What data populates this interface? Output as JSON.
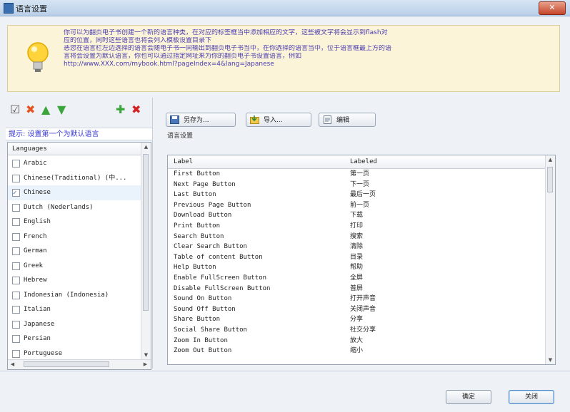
{
  "window": {
    "title": "语言设置",
    "close_label": "✕"
  },
  "info": {
    "lines": [
      "你可以为翻页电子书创建一个新的语言种类，在对应的标签框当中添加相应的文字，这些被文字将会显示到flash对",
      "应的位置，同时这些语言也将会列入模板设置目录下",
      "恶您在语言栏左边选择的语言会随电子书一同输出到翻页电子书当中，在你选择的语言当中，位于语言框最上方的语",
      "言将会设置为默认语言，你也可以通过指定网址来为你的翻页电子书设置语言，例如",
      "http://www.XXX.com/mybook.html?pageIndex=4&lang=Japanese"
    ]
  },
  "left": {
    "toolbar_icons": [
      {
        "name": "check-all-icon",
        "glyph": "☑",
        "color": "#555555"
      },
      {
        "name": "remove-icon",
        "glyph": "✖",
        "color": "#e2541f"
      },
      {
        "name": "move-up-icon",
        "glyph": "▲",
        "color": "#3aa53a"
      },
      {
        "name": "move-down-icon",
        "glyph": "▼",
        "color": "#3aa53a"
      },
      {
        "name": "add-language-icon",
        "glyph": "✚",
        "color": "#3aa53a"
      },
      {
        "name": "delete-language-icon",
        "glyph": "✖",
        "color": "#d42020"
      }
    ],
    "hint": "提示: 设置第一个为默认语言",
    "list_header": "Languages",
    "languages": [
      {
        "label": "Arabic",
        "checked": false
      },
      {
        "label": "Chinese(Traditional) (中...",
        "checked": false
      },
      {
        "label": "Chinese",
        "checked": true
      },
      {
        "label": "Dutch (Nederlands)",
        "checked": false
      },
      {
        "label": "English",
        "checked": false
      },
      {
        "label": "French",
        "checked": false
      },
      {
        "label": "German",
        "checked": false
      },
      {
        "label": "Greek",
        "checked": false
      },
      {
        "label": "Hebrew",
        "checked": false
      },
      {
        "label": "Indonesian (Indonesia)",
        "checked": false
      },
      {
        "label": "Italian",
        "checked": false
      },
      {
        "label": "Japanese",
        "checked": false
      },
      {
        "label": "Persian",
        "checked": false
      },
      {
        "label": "Portuguese",
        "checked": false
      }
    ]
  },
  "right": {
    "buttons": {
      "save_as": "另存为...",
      "import": "导入...",
      "edit": "编辑"
    },
    "section_label": "语言设置",
    "grid_headers": {
      "label": "Label",
      "labeled": "Labeled"
    },
    "rows": [
      {
        "label": "First Button",
        "value": "第一页"
      },
      {
        "label": "Next Page Button",
        "value": "下一页"
      },
      {
        "label": "Last Button",
        "value": "最后一页"
      },
      {
        "label": "Previous Page Button",
        "value": "前一页"
      },
      {
        "label": "Download Button",
        "value": "下载"
      },
      {
        "label": "Print Button",
        "value": "打印"
      },
      {
        "label": "Search Button",
        "value": "搜索"
      },
      {
        "label": "Clear Search Button",
        "value": "清除"
      },
      {
        "label": "Table of content Button",
        "value": "目录"
      },
      {
        "label": "Help Button",
        "value": "帮助"
      },
      {
        "label": "Enable FullScreen Button",
        "value": "全屏"
      },
      {
        "label": "Disable FullScreen Button",
        "value": "普屏"
      },
      {
        "label": "Sound On Button",
        "value": "打开声音"
      },
      {
        "label": "Sound Off Button",
        "value": "关闭声音"
      },
      {
        "label": "Share Button",
        "value": "分享"
      },
      {
        "label": "Social Share Button",
        "value": "社交分享"
      },
      {
        "label": "Zoom In Button",
        "value": "放大"
      },
      {
        "label": "Zoom Out Button",
        "value": "缩小"
      }
    ]
  },
  "footer": {
    "ok": "确定",
    "close": "关闭"
  }
}
